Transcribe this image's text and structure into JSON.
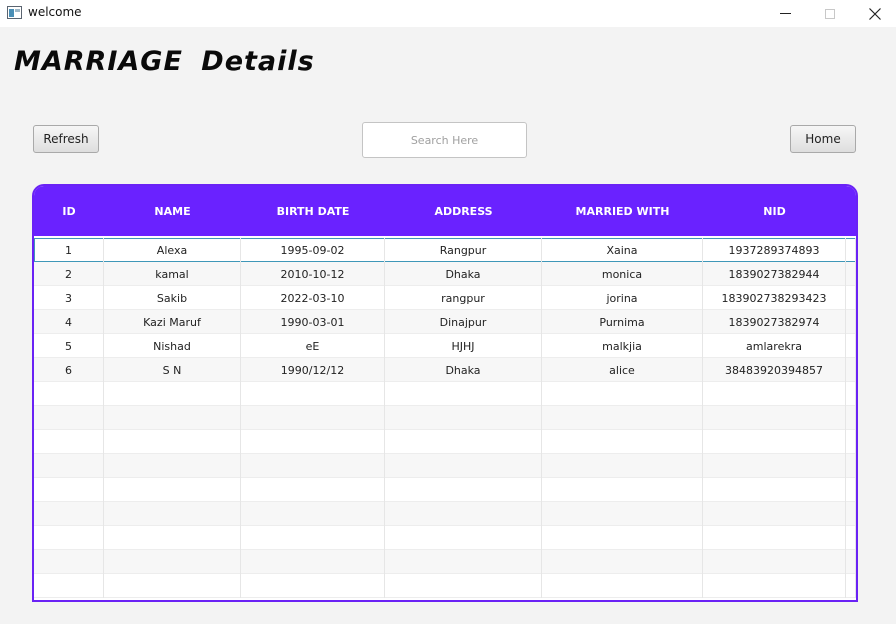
{
  "window": {
    "title": "welcome",
    "icon": "app-window-icon"
  },
  "header": {
    "title": "MARRIAGE  Details"
  },
  "toolbar": {
    "refresh_label": "Refresh",
    "home_label": "Home",
    "search_placeholder": "Search Here",
    "search_value": ""
  },
  "table": {
    "header_color": "#6a22ff",
    "columns": [
      "ID",
      "NAME",
      "BIRTH DATE",
      "ADDRESS",
      "MARRIED WITH",
      "NID"
    ],
    "selected_row": 0,
    "rows": [
      [
        "1",
        "Alexa",
        "1995-09-02",
        "Rangpur",
        "Xaina",
        "1937289374893"
      ],
      [
        "2",
        "kamal",
        "2010-10-12",
        "Dhaka",
        "monica",
        "1839027382944"
      ],
      [
        "3",
        "Sakib",
        "2022-03-10",
        "rangpur",
        "jorina",
        "183902738293423"
      ],
      [
        "4",
        "Kazi Maruf",
        "1990-03-01",
        "Dinajpur",
        "Purnima",
        "1839027382974"
      ],
      [
        "5",
        "Nishad",
        "eE",
        "HJHJ",
        "malkjia",
        "amlarekra"
      ],
      [
        "6",
        "S N",
        "1990/12/12",
        "Dhaka",
        "alice",
        "38483920394857"
      ]
    ],
    "empty_rows": 9
  }
}
